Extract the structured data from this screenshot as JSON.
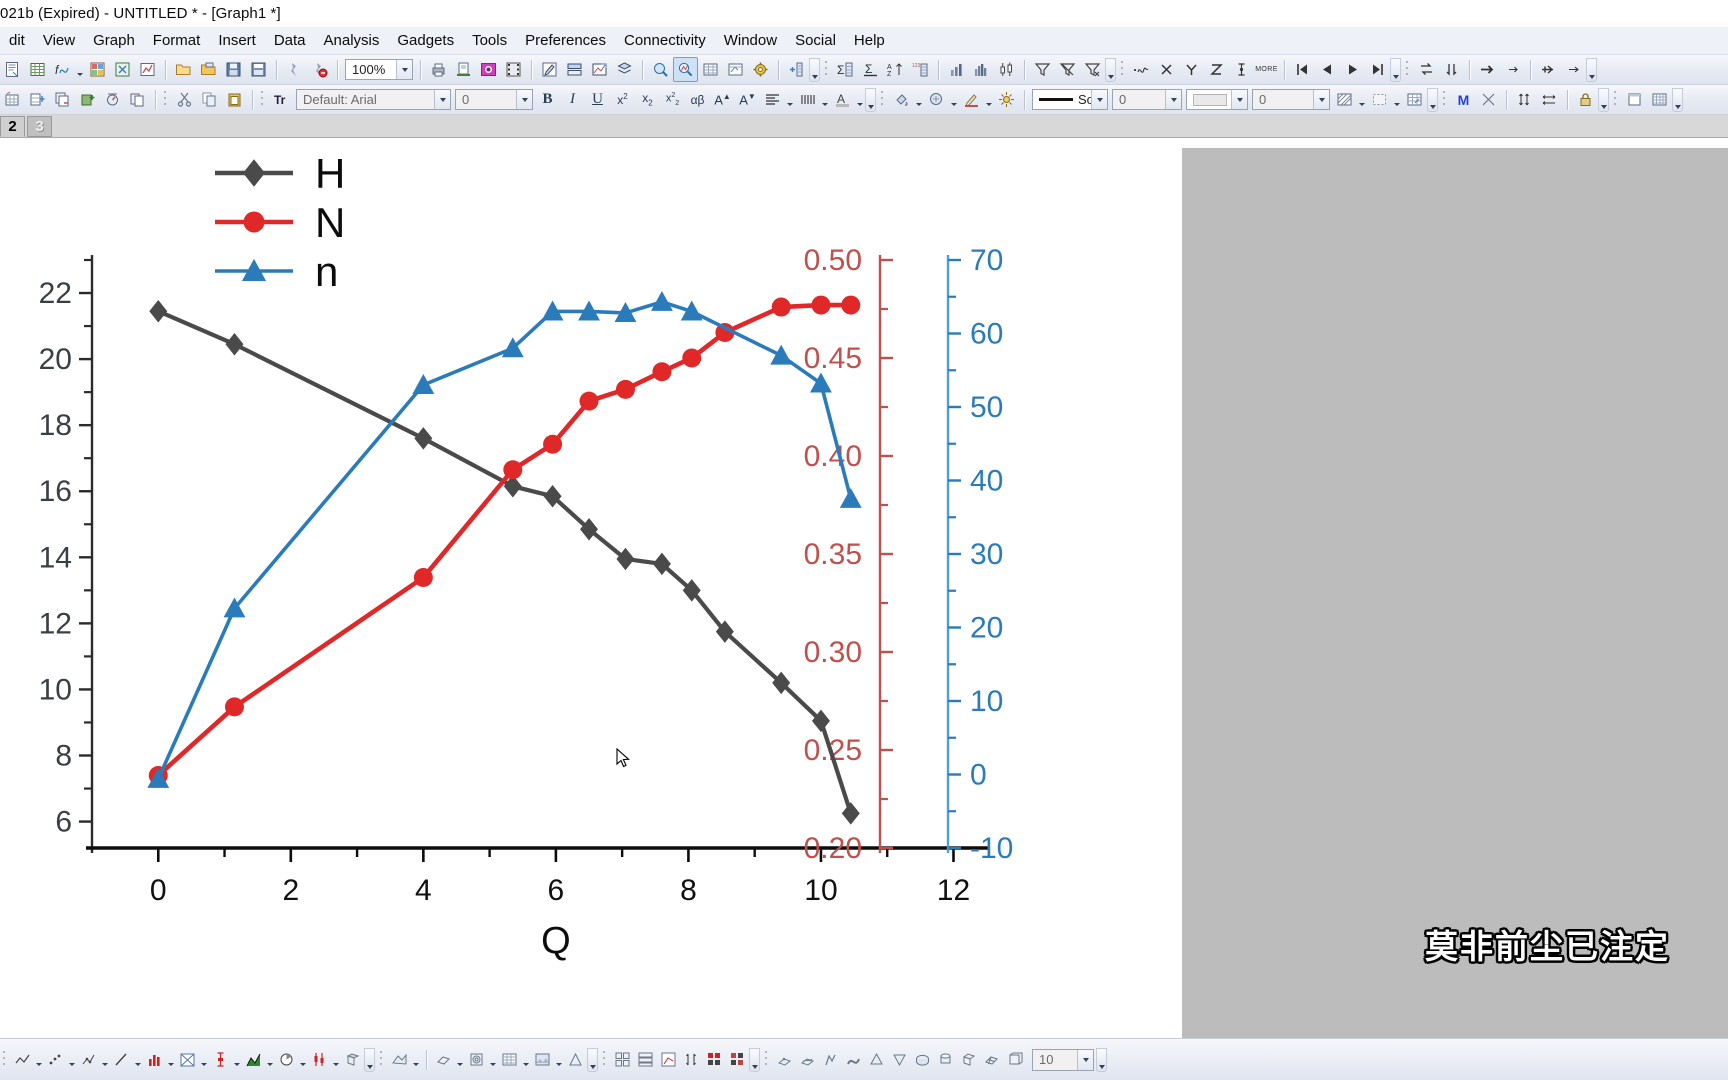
{
  "window": {
    "title": "021b (Expired) - UNTITLED * - [Graph1 *]"
  },
  "menubar": {
    "items": [
      {
        "label": "dit"
      },
      {
        "label": "View"
      },
      {
        "label": "Graph"
      },
      {
        "label": "Format"
      },
      {
        "label": "Insert"
      },
      {
        "label": "Data"
      },
      {
        "label": "Analysis"
      },
      {
        "label": "Gadgets"
      },
      {
        "label": "Tools"
      },
      {
        "label": "Preferences"
      },
      {
        "label": "Connectivity"
      },
      {
        "label": "Window"
      },
      {
        "label": "Social"
      },
      {
        "label": "Help"
      }
    ]
  },
  "toolbar": {
    "zoom_value": "100%",
    "font_value": "Default: Arial",
    "font_size_value": "0",
    "line_style_value": "Sol",
    "line_width_value": "0",
    "fill_pattern_value": "0",
    "bottom_value": "10",
    "icons_row1": [
      "new-project-icon",
      "new-workbook-icon",
      "new-function-plot-icon",
      "new-matrix-icon",
      "new-excel-icon",
      "new-layout-icon",
      "open-icon",
      "open-template-icon",
      "save-project-icon",
      "save-window-icon",
      "run-script-icon",
      "stop-script-icon"
    ],
    "icons_row1b": [
      "print-icon",
      "print-preview-icon",
      "export-graph-icon",
      "video-builder-icon",
      "annotate-icon",
      "merge-graph-icon",
      "extract-graph-icon",
      "layer-management-icon"
    ],
    "icons_row1c": [
      "zoom-panel-icon",
      "data-reader-icon",
      "worksheet-data-icon",
      "select-data-icon",
      "gear-icon",
      "add-scale-icon"
    ],
    "icons_row1d": [
      "statistics-icon",
      "sum-icon",
      "sort-icon",
      "frequency-count-icon",
      "column-chart-icon",
      "histogram-icon",
      "box-chart-icon",
      "filter-icon",
      "clear-filter-icon",
      "reapply-filter-icon"
    ],
    "icons_row1e": [
      "add-curve-icon",
      "x-function-icon",
      "y-function-icon",
      "z-function-icon",
      "more-icon"
    ],
    "icons_row1f": [
      "first-frame-icon",
      "prev-frame-icon",
      "next-frame-icon",
      "last-frame-icon"
    ],
    "icons_row1g": [
      "swap-columns-icon",
      "sort-descending-icon",
      "move-right-icon",
      "step-right-icon",
      "shift-right-icon",
      "arrow-right-icon"
    ],
    "icons_row2a": [
      "new-layer-icon",
      "add-column-icon",
      "copy-layer-icon",
      "add-plot-icon",
      "speed-mode-icon",
      "duplicate-icon"
    ],
    "icons_row2b": [
      "cut-icon",
      "copy-icon",
      "paste-icon"
    ],
    "icons_row2c": [
      "bold-icon",
      "italic-icon",
      "underline-icon",
      "superscript-icon",
      "subscript-icon",
      "super-sub-icon",
      "greek-icon",
      "increase-font-icon",
      "decrease-font-icon",
      "align-icon",
      "spacing-icon",
      "text-color-icon"
    ],
    "icons_row2d": [
      "fill-color-icon",
      "pattern-color-icon",
      "line-color-icon",
      "brightness-icon"
    ],
    "icons_row2e": [
      "pattern-fill-icon",
      "border-style-icon",
      "grid-style-icon"
    ],
    "icons_row2f": [
      "masking-icon",
      "unmask-icon",
      "vertical-cursor-icon",
      "horizontal-cursor-icon",
      "lock-icon",
      "new-window-icon",
      "grid-icon"
    ]
  },
  "tabs": {
    "items": [
      {
        "label": "2",
        "active": true
      },
      {
        "label": "3",
        "active": false
      }
    ]
  },
  "subtitle": {
    "text": "莫非前尘已注定"
  },
  "chart_data": {
    "type": "line",
    "title": "",
    "xlabel": "Q",
    "ylabel": "",
    "xlim": [
      -1.0,
      12.4
    ],
    "xticks": [
      0,
      2,
      4,
      6,
      8,
      10,
      12
    ],
    "grid": false,
    "legend_position": "top-left",
    "axes": [
      {
        "name": "H",
        "side": "left",
        "color": "#4a4a4a",
        "lim": [
          5.2,
          23.0
        ],
        "ticks": [
          6,
          8,
          10,
          12,
          14,
          16,
          18,
          20,
          22
        ],
        "minor_ticks": true
      },
      {
        "name": "N",
        "side": "right-inner",
        "color": "#c0504d",
        "lim": [
          0.2,
          0.5
        ],
        "ticks": [
          "0.20",
          "0.25",
          "0.30",
          "0.35",
          "0.40",
          "0.45",
          "0.50"
        ],
        "minor_ticks": true
      },
      {
        "name": "n",
        "side": "right-outer",
        "color": "#2b7bba",
        "lim": [
          -10,
          70
        ],
        "ticks": [
          -10,
          0,
          10,
          20,
          30,
          40,
          50,
          60,
          70
        ],
        "minor_ticks": true
      }
    ],
    "series": [
      {
        "name": "H",
        "axis": "left",
        "color": "#4a4a4a",
        "marker": "diamond",
        "x": [
          0.0,
          1.15,
          4.0,
          5.35,
          5.95,
          6.5,
          7.05,
          7.6,
          8.05,
          8.55,
          9.4,
          10.0,
          10.45
        ],
        "y": [
          21.45,
          20.45,
          17.6,
          16.15,
          15.85,
          14.85,
          13.95,
          13.8,
          13.0,
          11.75,
          10.2,
          9.05,
          6.25
        ]
      },
      {
        "name": "N",
        "axis": "right-inner",
        "color": "#e02828",
        "marker": "circle",
        "x": [
          0.0,
          1.15,
          4.0,
          5.35,
          5.95,
          6.5,
          7.05,
          7.6,
          8.05,
          8.55,
          9.4,
          10.0,
          10.45
        ],
        "y": [
          0.237,
          0.272,
          0.338,
          0.393,
          0.406,
          0.428,
          0.434,
          0.443,
          0.45,
          0.463,
          0.476,
          0.477,
          0.477
        ]
      },
      {
        "name": "n",
        "axis": "right-outer",
        "color": "#2b7bba",
        "marker": "triangle",
        "x": [
          0.0,
          1.15,
          4.0,
          5.35,
          5.95,
          6.5,
          7.05,
          7.6,
          8.05,
          9.4,
          10.0,
          10.45
        ],
        "y": [
          -0.6,
          22.6,
          53.0,
          58.0,
          63.0,
          63.0,
          62.8,
          64.3,
          63.0,
          57.0,
          53.2,
          37.5
        ]
      }
    ],
    "legend": [
      {
        "label": "H",
        "color": "#4a4a4a",
        "marker": "diamond"
      },
      {
        "label": "N",
        "color": "#e02828",
        "marker": "circle"
      },
      {
        "label": "n",
        "color": "#2b7bba",
        "marker": "triangle"
      }
    ]
  }
}
